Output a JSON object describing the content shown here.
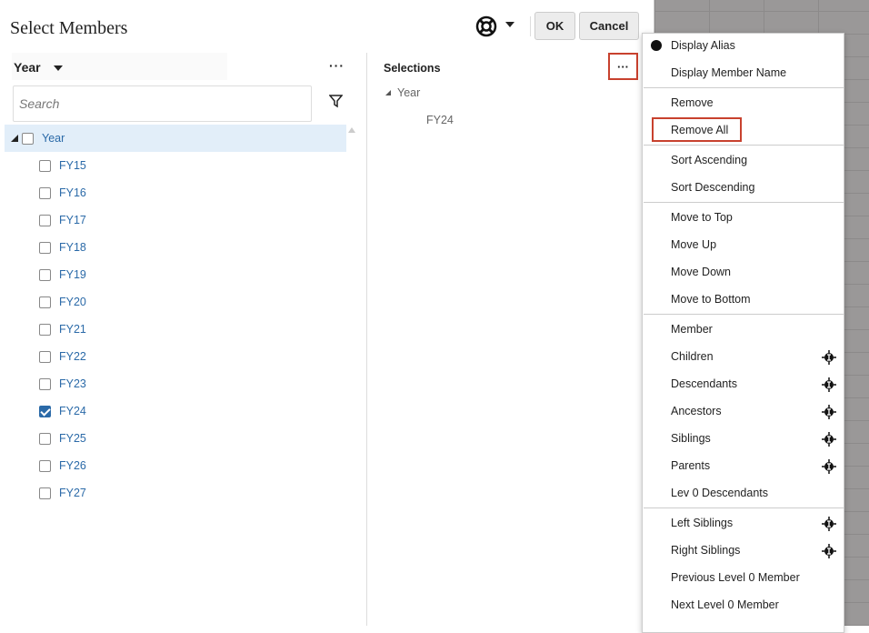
{
  "dialog": {
    "title": "Select Members",
    "ok": "OK",
    "cancel": "Cancel",
    "help_icon": "lifebuoy-icon"
  },
  "left": {
    "dimension": "Year",
    "search_placeholder": "Search",
    "tree": {
      "root": "Year",
      "root_checked": false,
      "items": [
        {
          "label": "FY15",
          "checked": false
        },
        {
          "label": "FY16",
          "checked": false
        },
        {
          "label": "FY17",
          "checked": false
        },
        {
          "label": "FY18",
          "checked": false
        },
        {
          "label": "FY19",
          "checked": false
        },
        {
          "label": "FY20",
          "checked": false
        },
        {
          "label": "FY21",
          "checked": false
        },
        {
          "label": "FY22",
          "checked": false
        },
        {
          "label": "FY23",
          "checked": false
        },
        {
          "label": "FY24",
          "checked": true
        },
        {
          "label": "FY25",
          "checked": false
        },
        {
          "label": "FY26",
          "checked": false
        },
        {
          "label": "FY27",
          "checked": false
        }
      ]
    }
  },
  "selections": {
    "header": "Selections",
    "group": "Year",
    "items": [
      "FY24"
    ]
  },
  "menu": {
    "groups": [
      [
        {
          "label": "Display Alias",
          "selected": true
        },
        {
          "label": "Display Member Name"
        }
      ],
      [
        {
          "label": "Remove"
        },
        {
          "label": "Remove All",
          "highlighted": true
        }
      ],
      [
        {
          "label": "Sort Ascending"
        },
        {
          "label": "Sort Descending"
        }
      ],
      [
        {
          "label": "Move to Top"
        },
        {
          "label": "Move Up"
        },
        {
          "label": "Move Down"
        },
        {
          "label": "Move to Bottom"
        }
      ],
      [
        {
          "label": "Member"
        },
        {
          "label": "Children",
          "picker": true
        },
        {
          "label": "Descendants",
          "picker": true
        },
        {
          "label": "Ancestors",
          "picker": true
        },
        {
          "label": "Siblings",
          "picker": true
        },
        {
          "label": "Parents",
          "picker": true
        },
        {
          "label": "Lev 0 Descendants"
        }
      ],
      [
        {
          "label": "Left Siblings",
          "picker": true
        },
        {
          "label": "Right Siblings",
          "picker": true
        },
        {
          "label": "Previous Level 0 Member"
        },
        {
          "label": "Next Level 0 Member"
        }
      ]
    ]
  },
  "colors": {
    "accent": "#2b6aa8",
    "highlight": "#c8412e"
  }
}
